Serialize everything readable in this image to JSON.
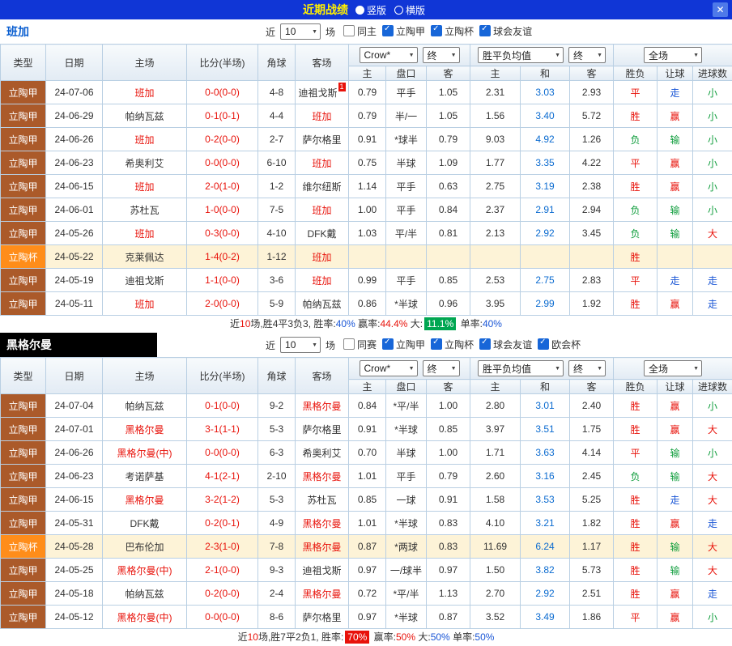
{
  "titlebar": {
    "title": "近期战绩",
    "radios": [
      {
        "label": "竖版",
        "checked": true
      },
      {
        "label": "横版",
        "checked": false
      }
    ],
    "close_glyph": "✕"
  },
  "sections": [
    {
      "team": "班加",
      "filters": {
        "prefix": "近",
        "count": "10",
        "suffix": "场",
        "options": [
          {
            "label": "同主",
            "checked": false
          },
          {
            "label": "立陶甲",
            "checked": true
          },
          {
            "label": "立陶杯",
            "checked": true
          },
          {
            "label": "球会友谊",
            "checked": true
          }
        ]
      },
      "dropdowns": {
        "bookmaker": "Crow*",
        "bookmaker_state": "终",
        "europe": "胜平负均值",
        "europe_state": "终",
        "scope": "全场"
      },
      "columns": {
        "type": "类型",
        "date": "日期",
        "home": "主场",
        "score": "比分(半场)",
        "corner": "角球",
        "away": "客场",
        "asian_home": "主",
        "asian_line": "盘口",
        "asian_away": "客",
        "euro_home": "主",
        "euro_draw": "和",
        "euro_away": "客",
        "result": "胜负",
        "handicap": "让球",
        "goals": "进球数"
      },
      "rows": [
        {
          "league": "立陶甲",
          "league_state": "league",
          "date": "24-07-06",
          "home": "班加",
          "home_state": "focus",
          "score": "0-0(0-0)",
          "corner": "4-8",
          "away": "迪祖戈斯",
          "away_state": "",
          "away_badge": "1",
          "odds_home": "0.79",
          "odds_line": "平手",
          "odds_away": "1.05",
          "eu_home": "2.31",
          "eu_draw": "3.03",
          "eu_away": "2.93",
          "result": "平",
          "result_state": "draw",
          "handicap": "走",
          "handicap_state": "push",
          "goals": "小",
          "goals_state": "under"
        },
        {
          "league": "立陶甲",
          "league_state": "league",
          "date": "24-06-29",
          "home": "帕纳瓦兹",
          "home_state": "",
          "score": "0-1(0-1)",
          "corner": "4-4",
          "away": "班加",
          "away_state": "focus",
          "odds_home": "0.79",
          "odds_line": "半/一",
          "odds_away": "1.05",
          "eu_home": "1.56",
          "eu_draw": "3.40",
          "eu_away": "5.72",
          "result": "胜",
          "result_state": "win",
          "handicap": "赢",
          "handicap_state": "win",
          "goals": "小",
          "goals_state": "under"
        },
        {
          "league": "立陶甲",
          "league_state": "league",
          "date": "24-06-26",
          "home": "班加",
          "home_state": "focus",
          "score": "0-2(0-0)",
          "corner": "2-7",
          "away": "萨尔格里",
          "away_state": "",
          "odds_home": "0.91",
          "odds_line": "*球半",
          "odds_away": "0.79",
          "eu_home": "9.03",
          "eu_draw": "4.92",
          "eu_away": "1.26",
          "result": "负",
          "result_state": "lose",
          "handicap": "输",
          "handicap_state": "lose",
          "goals": "小",
          "goals_state": "under"
        },
        {
          "league": "立陶甲",
          "league_state": "league",
          "date": "24-06-23",
          "home": "希奥利艾",
          "home_state": "",
          "score": "0-0(0-0)",
          "corner": "6-10",
          "away": "班加",
          "away_state": "focus",
          "odds_home": "0.75",
          "odds_line": "半球",
          "odds_away": "1.09",
          "eu_home": "1.77",
          "eu_draw": "3.35",
          "eu_away": "4.22",
          "result": "平",
          "result_state": "draw",
          "handicap": "赢",
          "handicap_state": "win",
          "goals": "小",
          "goals_state": "under"
        },
        {
          "league": "立陶甲",
          "league_state": "league",
          "date": "24-06-15",
          "home": "班加",
          "home_state": "focus",
          "score": "2-0(1-0)",
          "corner": "1-2",
          "away": "维尔纽斯",
          "away_state": "",
          "odds_home": "1.14",
          "odds_line": "平手",
          "odds_away": "0.63",
          "eu_home": "2.75",
          "eu_draw": "3.19",
          "eu_away": "2.38",
          "result": "胜",
          "result_state": "win",
          "handicap": "赢",
          "handicap_state": "win",
          "goals": "小",
          "goals_state": "under"
        },
        {
          "league": "立陶甲",
          "league_state": "league",
          "date": "24-06-01",
          "home": "苏杜瓦",
          "home_state": "",
          "score": "1-0(0-0)",
          "corner": "7-5",
          "away": "班加",
          "away_state": "focus",
          "odds_home": "1.00",
          "odds_line": "平手",
          "odds_away": "0.84",
          "eu_home": "2.37",
          "eu_draw": "2.91",
          "eu_away": "2.94",
          "result": "负",
          "result_state": "lose",
          "handicap": "输",
          "handicap_state": "lose",
          "goals": "小",
          "goals_state": "under"
        },
        {
          "league": "立陶甲",
          "league_state": "league",
          "date": "24-05-26",
          "home": "班加",
          "home_state": "focus",
          "score": "0-3(0-0)",
          "corner": "4-10",
          "away": "DFK戴",
          "away_state": "",
          "odds_home": "1.03",
          "odds_line": "平/半",
          "odds_away": "0.81",
          "eu_home": "2.13",
          "eu_draw": "2.92",
          "eu_away": "3.45",
          "result": "负",
          "result_state": "lose",
          "handicap": "输",
          "handicap_state": "lose",
          "goals": "大",
          "goals_state": "over"
        },
        {
          "league": "立陶杯",
          "league_state": "cup",
          "row_state": "highlight",
          "date": "24-05-22",
          "home": "克莱佩达",
          "home_state": "",
          "score": "1-4(0-2)",
          "corner": "1-12",
          "away": "班加",
          "away_state": "focus",
          "odds_home": "",
          "odds_line": "",
          "odds_away": "",
          "eu_home": "",
          "eu_draw": "",
          "eu_away": "",
          "result": "胜",
          "result_state": "win",
          "handicap": "",
          "handicap_state": "",
          "goals": "",
          "goals_state": ""
        },
        {
          "league": "立陶甲",
          "league_state": "league",
          "date": "24-05-19",
          "home": "迪祖戈斯",
          "home_state": "",
          "score": "1-1(0-0)",
          "corner": "3-6",
          "away": "班加",
          "away_state": "focus",
          "odds_home": "0.99",
          "odds_line": "平手",
          "odds_away": "0.85",
          "eu_home": "2.53",
          "eu_draw": "2.75",
          "eu_away": "2.83",
          "result": "平",
          "result_state": "draw",
          "handicap": "走",
          "handicap_state": "push",
          "goals": "走",
          "goals_state": "push"
        },
        {
          "league": "立陶甲",
          "league_state": "league",
          "date": "24-05-11",
          "home": "班加",
          "home_state": "focus",
          "score": "2-0(0-0)",
          "corner": "5-9",
          "away": "帕纳瓦兹",
          "away_state": "",
          "odds_home": "0.86",
          "odds_line": "*半球",
          "odds_away": "0.96",
          "eu_home": "3.95",
          "eu_draw": "2.99",
          "eu_away": "1.92",
          "result": "胜",
          "result_state": "win",
          "handicap": "赢",
          "handicap_state": "win",
          "goals": "走",
          "goals_state": "push"
        }
      ],
      "summary": [
        {
          "text": "近",
          "state": ""
        },
        {
          "text": "10",
          "state": "red"
        },
        {
          "text": "场,胜4平3负3, 胜率:",
          "state": ""
        },
        {
          "text": "40%",
          "state": "blue"
        },
        {
          "text": " 赢率:",
          "state": ""
        },
        {
          "text": "44.4%",
          "state": "red"
        },
        {
          "text": " 大:",
          "state": ""
        },
        {
          "text": "11.1%",
          "state": "green-badge"
        },
        {
          "text": " 单率:",
          "state": ""
        },
        {
          "text": "40%",
          "state": "blue"
        }
      ]
    },
    {
      "team": "黑格尔曼",
      "filters": {
        "prefix": "近",
        "count": "10",
        "suffix": "场",
        "options": [
          {
            "label": "同赛",
            "checked": false
          },
          {
            "label": "立陶甲",
            "checked": true
          },
          {
            "label": "立陶杯",
            "checked": true
          },
          {
            "label": "球会友谊",
            "checked": true
          },
          {
            "label": "欧会杯",
            "checked": true
          }
        ]
      },
      "dropdowns": {
        "bookmaker": "Crow*",
        "bookmaker_state": "终",
        "europe": "胜平负均值",
        "europe_state": "终",
        "scope": "全场"
      },
      "columns": {
        "type": "类型",
        "date": "日期",
        "home": "主场",
        "score": "比分(半场)",
        "corner": "角球",
        "away": "客场",
        "asian_home": "主",
        "asian_line": "盘口",
        "asian_away": "客",
        "euro_home": "主",
        "euro_draw": "和",
        "euro_away": "客",
        "result": "胜负",
        "handicap": "让球",
        "goals": "进球数"
      },
      "rows": [
        {
          "league": "立陶甲",
          "league_state": "league",
          "date": "24-07-04",
          "home": "帕纳瓦兹",
          "home_state": "",
          "score": "0-1(0-0)",
          "corner": "9-2",
          "away": "黑格尔曼",
          "away_state": "focus",
          "odds_home": "0.84",
          "odds_line": "*平/半",
          "odds_away": "1.00",
          "eu_home": "2.80",
          "eu_draw": "3.01",
          "eu_away": "2.40",
          "result": "胜",
          "result_state": "win",
          "handicap": "赢",
          "handicap_state": "win",
          "goals": "小",
          "goals_state": "under"
        },
        {
          "league": "立陶甲",
          "league_state": "league",
          "date": "24-07-01",
          "home": "黑格尔曼",
          "home_state": "focus",
          "score": "3-1(1-1)",
          "corner": "5-3",
          "away": "萨尔格里",
          "away_state": "",
          "odds_home": "0.91",
          "odds_line": "*半球",
          "odds_away": "0.85",
          "eu_home": "3.97",
          "eu_draw": "3.51",
          "eu_away": "1.75",
          "result": "胜",
          "result_state": "win",
          "handicap": "赢",
          "handicap_state": "win",
          "goals": "大",
          "goals_state": "over"
        },
        {
          "league": "立陶甲",
          "league_state": "league",
          "date": "24-06-26",
          "home": "黑格尔曼(中)",
          "home_state": "focus",
          "score": "0-0(0-0)",
          "corner": "6-3",
          "away": "希奥利艾",
          "away_state": "",
          "odds_home": "0.70",
          "odds_line": "半球",
          "odds_away": "1.00",
          "eu_home": "1.71",
          "eu_draw": "3.63",
          "eu_away": "4.14",
          "result": "平",
          "result_state": "draw",
          "handicap": "输",
          "handicap_state": "lose",
          "goals": "小",
          "goals_state": "under"
        },
        {
          "league": "立陶甲",
          "league_state": "league",
          "date": "24-06-23",
          "home": "考诺萨基",
          "home_state": "",
          "score": "4-1(2-1)",
          "corner": "2-10",
          "away": "黑格尔曼",
          "away_state": "focus",
          "odds_home": "1.01",
          "odds_line": "平手",
          "odds_away": "0.79",
          "eu_home": "2.60",
          "eu_draw": "3.16",
          "eu_away": "2.45",
          "result": "负",
          "result_state": "lose",
          "handicap": "输",
          "handicap_state": "lose",
          "goals": "大",
          "goals_state": "over"
        },
        {
          "league": "立陶甲",
          "league_state": "league",
          "date": "24-06-15",
          "home": "黑格尔曼",
          "home_state": "focus",
          "score": "3-2(1-2)",
          "corner": "5-3",
          "away": "苏杜瓦",
          "away_state": "",
          "odds_home": "0.85",
          "odds_line": "一球",
          "odds_away": "0.91",
          "eu_home": "1.58",
          "eu_draw": "3.53",
          "eu_away": "5.25",
          "result": "胜",
          "result_state": "win",
          "handicap": "走",
          "handicap_state": "push",
          "goals": "大",
          "goals_state": "over"
        },
        {
          "league": "立陶甲",
          "league_state": "league",
          "date": "24-05-31",
          "home": "DFK戴",
          "home_state": "",
          "score": "0-2(0-1)",
          "corner": "4-9",
          "away": "黑格尔曼",
          "away_state": "focus",
          "odds_home": "1.01",
          "odds_line": "*半球",
          "odds_away": "0.83",
          "eu_home": "4.10",
          "eu_draw": "3.21",
          "eu_away": "1.82",
          "result": "胜",
          "result_state": "win",
          "handicap": "赢",
          "handicap_state": "win",
          "goals": "走",
          "goals_state": "push"
        },
        {
          "league": "立陶杯",
          "league_state": "cup",
          "row_state": "highlight",
          "date": "24-05-28",
          "home": "巴布伦加",
          "home_state": "",
          "score": "2-3(1-0)",
          "corner": "7-8",
          "away": "黑格尔曼",
          "away_state": "focus",
          "odds_home": "0.87",
          "odds_line": "*两球",
          "odds_away": "0.83",
          "eu_home": "11.69",
          "eu_draw": "6.24",
          "eu_away": "1.17",
          "result": "胜",
          "result_state": "win",
          "handicap": "输",
          "handicap_state": "lose",
          "goals": "大",
          "goals_state": "over"
        },
        {
          "league": "立陶甲",
          "league_state": "league",
          "date": "24-05-25",
          "home": "黑格尔曼(中)",
          "home_state": "focus",
          "score": "2-1(0-0)",
          "corner": "9-3",
          "away": "迪祖戈斯",
          "away_state": "",
          "odds_home": "0.97",
          "odds_line": "一/球半",
          "odds_away": "0.97",
          "eu_home": "1.50",
          "eu_draw": "3.82",
          "eu_away": "5.73",
          "result": "胜",
          "result_state": "win",
          "handicap": "输",
          "handicap_state": "lose",
          "goals": "大",
          "goals_state": "over"
        },
        {
          "league": "立陶甲",
          "league_state": "league",
          "date": "24-05-18",
          "home": "帕纳瓦兹",
          "home_state": "",
          "score": "0-2(0-0)",
          "corner": "2-4",
          "away": "黑格尔曼",
          "away_state": "focus",
          "odds_home": "0.72",
          "odds_line": "*平/半",
          "odds_away": "1.13",
          "eu_home": "2.70",
          "eu_draw": "2.92",
          "eu_away": "2.51",
          "result": "胜",
          "result_state": "win",
          "handicap": "赢",
          "handicap_state": "win",
          "goals": "走",
          "goals_state": "push"
        },
        {
          "league": "立陶甲",
          "league_state": "league",
          "date": "24-05-12",
          "home": "黑格尔曼(中)",
          "home_state": "focus",
          "score": "0-0(0-0)",
          "corner": "8-6",
          "away": "萨尔格里",
          "away_state": "",
          "odds_home": "0.97",
          "odds_line": "*半球",
          "odds_away": "0.87",
          "eu_home": "3.52",
          "eu_draw": "3.49",
          "eu_away": "1.86",
          "result": "平",
          "result_state": "draw",
          "handicap": "赢",
          "handicap_state": "win",
          "goals": "小",
          "goals_state": "under"
        }
      ],
      "summary": [
        {
          "text": "近",
          "state": ""
        },
        {
          "text": "10",
          "state": "red"
        },
        {
          "text": "场,胜7平2负1, 胜率:",
          "state": ""
        },
        {
          "text": "70%",
          "state": "red-badge"
        },
        {
          "text": " 赢率:",
          "state": ""
        },
        {
          "text": "50%",
          "state": "red"
        },
        {
          "text": " 大:",
          "state": ""
        },
        {
          "text": "50%",
          "state": "blue"
        },
        {
          "text": " 单率:",
          "state": ""
        },
        {
          "text": "50%",
          "state": "blue"
        }
      ]
    }
  ]
}
